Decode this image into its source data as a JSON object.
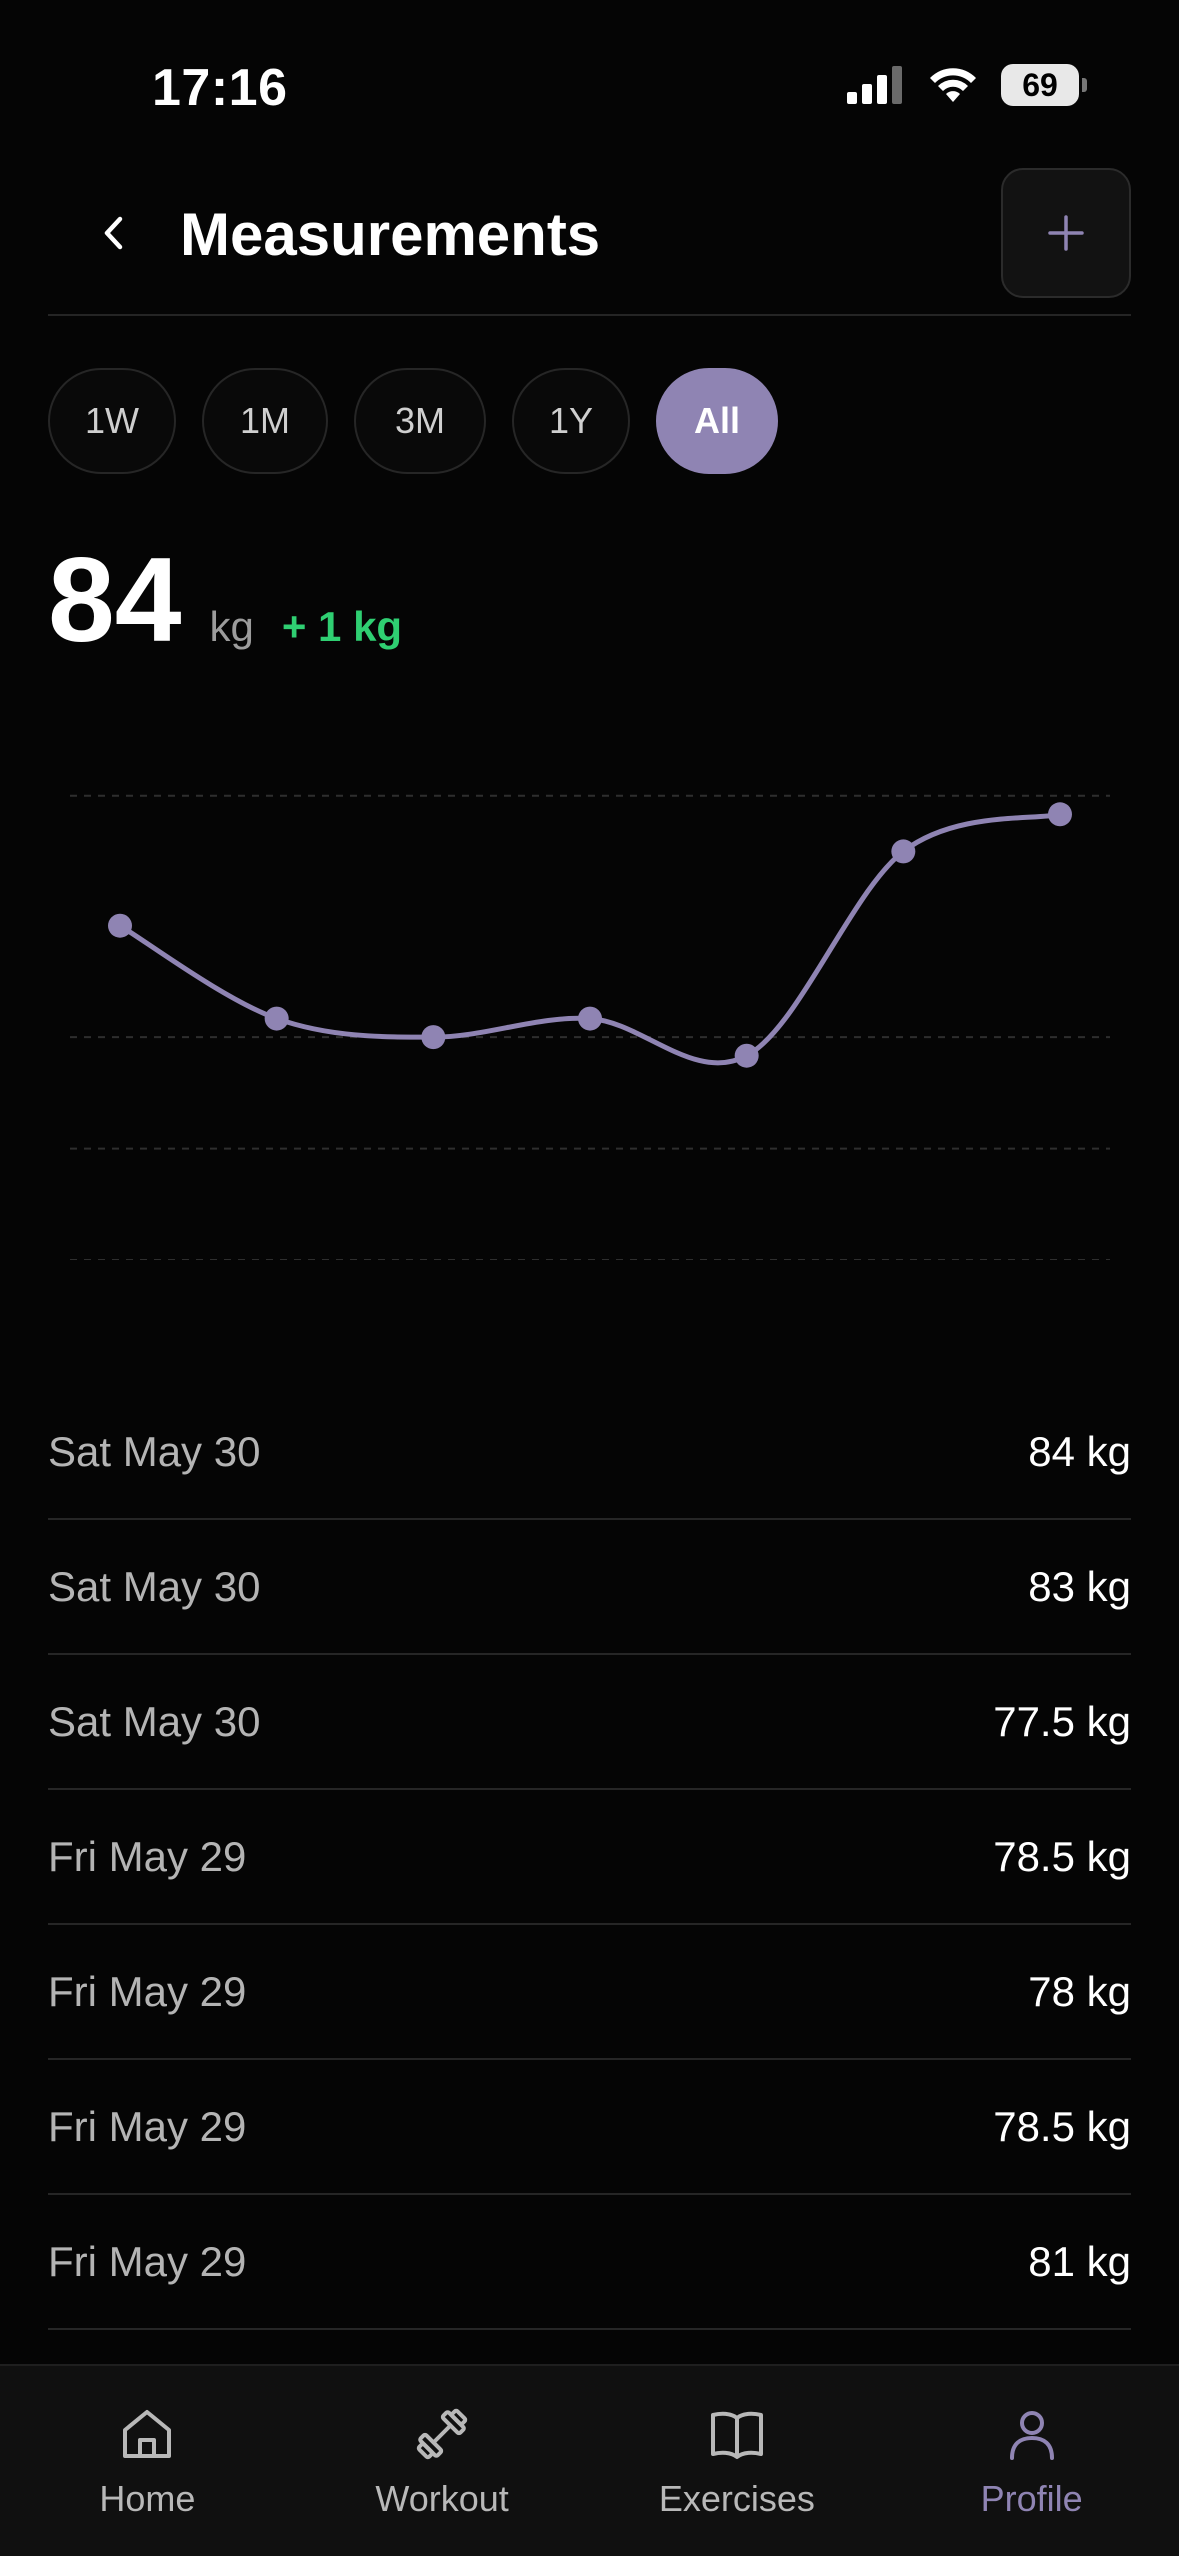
{
  "status_bar": {
    "time": "17:16",
    "battery": "69"
  },
  "header": {
    "title": "Measurements",
    "back_icon": "chevron-left-icon",
    "add_icon": "plus-icon"
  },
  "ranges": [
    {
      "label": "1W",
      "active": false
    },
    {
      "label": "1M",
      "active": false
    },
    {
      "label": "3M",
      "active": false
    },
    {
      "label": "1Y",
      "active": false
    },
    {
      "label": "All",
      "active": true
    }
  ],
  "current": {
    "value": "84",
    "unit": "kg",
    "delta": "+ 1 kg"
  },
  "colors": {
    "accent": "#8f84b3",
    "positive": "#2fcf72",
    "background": "#050505"
  },
  "chart_data": {
    "type": "line",
    "values": [
      81,
      78.5,
      78,
      78.5,
      77.5,
      83,
      84
    ],
    "ylim": [
      72,
      86
    ],
    "gridlines": [
      72,
      75,
      78,
      84.5
    ],
    "grid": true,
    "title": "",
    "xlabel": "",
    "ylabel": ""
  },
  "entries": [
    {
      "date": "Sat May 30",
      "value": "84 kg"
    },
    {
      "date": "Sat May 30",
      "value": "83 kg"
    },
    {
      "date": "Sat May 30",
      "value": "77.5 kg"
    },
    {
      "date": "Fri May 29",
      "value": "78.5 kg"
    },
    {
      "date": "Fri May 29",
      "value": "78 kg"
    },
    {
      "date": "Fri May 29",
      "value": "78.5 kg"
    },
    {
      "date": "Fri May 29",
      "value": "81 kg"
    }
  ],
  "tabs": [
    {
      "label": "Home",
      "icon": "home-icon",
      "active": false
    },
    {
      "label": "Workout",
      "icon": "dumbbell-icon",
      "active": false
    },
    {
      "label": "Exercises",
      "icon": "book-icon",
      "active": false
    },
    {
      "label": "Profile",
      "icon": "person-icon",
      "active": true
    }
  ]
}
